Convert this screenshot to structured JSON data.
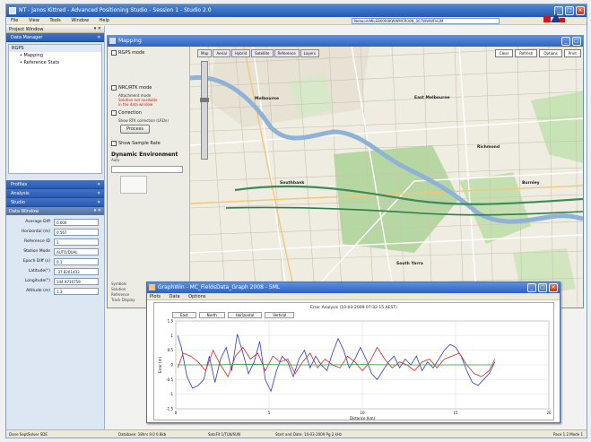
{
  "app": {
    "title": "NT - Janos Kittred - Advanced Positioning Studio - Session 1 - Studio 2.0",
    "menus": [
      "File",
      "View",
      "Tools",
      "Window",
      "Help"
    ],
    "address": "NetworkMILEB0000KWWMCR00N_007WWWFH2M"
  },
  "left": {
    "project_header": "Project Window",
    "section_top": "Data Manager",
    "tree_root": "RGPS",
    "tree_items": [
      "Mapping",
      "Reference Stats"
    ],
    "section_a": "Profiles",
    "section_b": "Analysis",
    "section_c": "Studio",
    "props_header": "Data Window",
    "props": [
      {
        "label": "Average Diff",
        "value": "0.000"
      },
      {
        "label": "Horizontal (m)",
        "value": "0.567"
      },
      {
        "label": "Reference ID",
        "value": "1"
      },
      {
        "label": "Station Mode",
        "value": "AUTO/DUAL"
      },
      {
        "label": "Epoch Diff (s)",
        "value": "0.1"
      },
      {
        "label": "Latitude(°)",
        "value": "-37.8201433"
      },
      {
        "label": "Longitude(°)",
        "value": "144.9716759"
      },
      {
        "label": "Altitude (m)",
        "value": "1.3"
      }
    ]
  },
  "mapwin": {
    "title": "Mapping",
    "controls": {
      "opt1": "RGPS mode",
      "opt2": "NRC/RTK mode",
      "attach": "Attachment mode",
      "warn": "Solution not available\nin the data window",
      "opt3": "Correction",
      "sub3": "Show RTK correction (LRDn)",
      "button": "Process",
      "opt4": "Show Sample Rate",
      "bold": "Dynamic Environment",
      "small": "Auto",
      "footer": [
        "Symbols",
        "Solution",
        "Reference",
        "Track Display"
      ]
    },
    "tabs": [
      "Map",
      "Aerial",
      "Hybrid",
      "Satellite",
      "Reference",
      "Layers"
    ],
    "buttons": [
      "Clear",
      "Refresh",
      "Options",
      "Print"
    ],
    "places": [
      "Melbourne",
      "Southbank",
      "East Melbourne",
      "Richmond",
      "South Yarra",
      "Burnley"
    ]
  },
  "graphwin": {
    "title": "GraphWin - MC_FieldsData_Graph 2008 - 5ML",
    "menus": [
      "Plots",
      "Data",
      "Options"
    ],
    "plot_title": "Error Analysis (10-03-2009 07:32:15 AEST)",
    "legend": [
      "East",
      "North",
      "Horizontal",
      "Vertical"
    ],
    "ylabel": "Error (m)",
    "xlabel": "Distance (km)"
  },
  "status": {
    "left": "Done  SeptSolver SDE",
    "s2": "Database: 18hrs 9.0 0.8kb",
    "s3": "SatsFit 1/TLN/6UN",
    "s4": "Start and Date: 10-03-2009  Pg 2 kHz",
    "right": "Pace 1.2 Mode 1"
  },
  "chart_data": {
    "type": "line",
    "title": "Error Analysis (10-03-2009 07:32:15 AEST)",
    "xlabel": "Distance (km)",
    "ylabel": "Error (m)",
    "xlim": [
      0,
      20
    ],
    "ylim": [
      -1.5,
      1.5
    ],
    "x_ticks": [
      0,
      5,
      10,
      15,
      20
    ],
    "y_ticks": [
      1.5,
      1.0,
      0.5,
      0,
      -0.5,
      -1.0,
      -1.5
    ],
    "grid": true,
    "series": [
      {
        "name": "East",
        "color": "#2a3bd0",
        "x": [
          0.1,
          0.3,
          0.6,
          0.9,
          1.2,
          1.5,
          1.8,
          2.1,
          2.4,
          2.7,
          3.0,
          3.3,
          3.6,
          3.9,
          4.2,
          4.5,
          4.8,
          5.1,
          5.4,
          5.7,
          6.0,
          6.3,
          6.6,
          6.9,
          7.2,
          7.5,
          7.8,
          8.1,
          8.4,
          8.7,
          9.0,
          9.3,
          9.6,
          9.9,
          10.2,
          10.5,
          10.8,
          11.1,
          11.4,
          11.7,
          12.0,
          12.3,
          12.6,
          12.9,
          13.2,
          13.5,
          13.8,
          14.1,
          14.4,
          14.7,
          15.0,
          15.3,
          15.6,
          15.9,
          16.2,
          16.5,
          16.8,
          17.1
        ],
        "y": [
          1.0,
          0.6,
          -0.4,
          -0.8,
          -0.7,
          -0.5,
          0.3,
          -0.6,
          0.2,
          0.6,
          -0.2,
          1.05,
          0.4,
          -0.3,
          0.1,
          0.8,
          -0.5,
          -0.9,
          -0.2,
          0.3,
          0.1,
          -0.4,
          0.2,
          0.5,
          -0.1,
          0.3,
          0.0,
          -0.2,
          0.4,
          0.9,
          0.5,
          -0.1,
          0.2,
          0.6,
          0.2,
          -0.3,
          -0.5,
          -0.2,
          0.1,
          0.3,
          -0.1,
          0.2,
          0.0,
          0.3,
          -0.2,
          0.1,
          -0.1,
          0.2,
          0.5,
          0.7,
          0.6,
          0.3,
          -0.2,
          -0.6,
          -0.7,
          -0.5,
          -0.3,
          0.1
        ]
      },
      {
        "name": "North",
        "color": "#d9261d",
        "x": [
          0.1,
          0.4,
          0.8,
          1.2,
          1.6,
          2.0,
          2.4,
          2.8,
          3.2,
          3.6,
          4.0,
          4.4,
          4.8,
          5.2,
          5.6,
          6.0,
          6.4,
          6.8,
          7.2,
          7.6,
          8.0,
          8.4,
          8.8,
          9.2,
          9.6,
          10.0,
          10.4,
          10.8,
          11.2,
          11.6,
          12.0,
          12.4,
          12.8,
          13.2,
          13.6,
          14.0,
          14.4,
          14.8,
          15.2,
          15.6,
          16.0,
          16.4,
          16.8,
          17.1
        ],
        "y": [
          -0.1,
          0.4,
          0.3,
          0.1,
          -0.2,
          0.5,
          0.0,
          -0.4,
          0.3,
          0.6,
          0.2,
          0.4,
          -0.2,
          0.3,
          0.1,
          0.2,
          -0.3,
          0.1,
          0.4,
          -0.1,
          0.2,
          0.0,
          -0.1,
          0.3,
          0.1,
          -0.2,
          0.1,
          0.6,
          0.2,
          -0.1,
          0.1,
          0.0,
          -0.2,
          0.1,
          0.2,
          -0.1,
          0.2,
          0.3,
          0.4,
          0.0,
          -0.3,
          -0.4,
          -0.2,
          0.2
        ]
      },
      {
        "name": "Horizontal",
        "color": "#27a33a",
        "x": [
          0.1,
          2.0,
          4.0,
          6.0,
          8.0,
          10.0,
          12.0,
          14.0,
          16.0,
          17.1
        ],
        "y": [
          0.0,
          0.0,
          0.02,
          0.0,
          0.0,
          0.01,
          0.0,
          0.0,
          0.0,
          0.0
        ]
      }
    ]
  }
}
